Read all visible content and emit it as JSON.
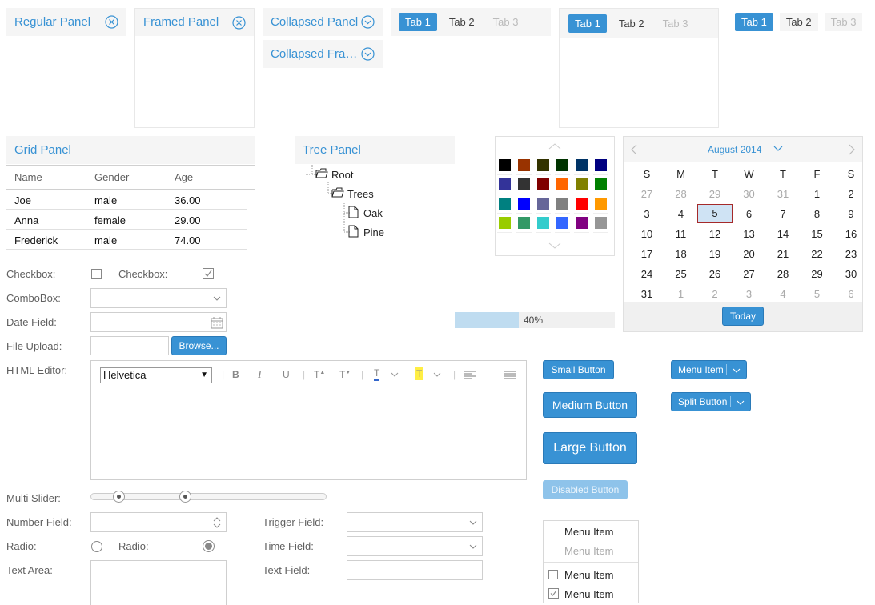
{
  "panels": {
    "regular": {
      "title": "Regular Panel"
    },
    "framed": {
      "title": "Framed Panel"
    },
    "collapsed": {
      "title": "Collapsed Panel"
    },
    "collapsed_framed": {
      "title": "Collapsed Fra…"
    }
  },
  "tabs": [
    "Tab 1",
    "Tab 2",
    "Tab 3"
  ],
  "grid": {
    "title": "Grid Panel",
    "columns": [
      "Name",
      "Gender",
      "Age"
    ],
    "rows": [
      [
        "Joe",
        "male",
        "36.00"
      ],
      [
        "Anna",
        "female",
        "29.00"
      ],
      [
        "Frederick",
        "male",
        "74.00"
      ]
    ]
  },
  "tree": {
    "title": "Tree Panel",
    "nodes": [
      "Root",
      "Trees",
      "Oak",
      "Pine"
    ]
  },
  "palette": {
    "colors": [
      "#000000",
      "#993300",
      "#333300",
      "#003300",
      "#003366",
      "#000080",
      "#333399",
      "#333333",
      "#800000",
      "#ff6600",
      "#808000",
      "#008000",
      "#008080",
      "#0000ff",
      "#666699",
      "#808080",
      "#ff0000",
      "#ff9900",
      "#99cc00",
      "#339966",
      "#33cccc",
      "#3366ff",
      "#800080",
      "#969696"
    ]
  },
  "calendar": {
    "month": "August 2014",
    "weekdays": [
      "S",
      "M",
      "T",
      "W",
      "T",
      "F",
      "S"
    ],
    "weeks": [
      [
        "27",
        "28",
        "29",
        "30",
        "31",
        "1",
        "2"
      ],
      [
        "3",
        "4",
        "5",
        "6",
        "7",
        "8",
        "9"
      ],
      [
        "10",
        "11",
        "12",
        "13",
        "14",
        "15",
        "16"
      ],
      [
        "17",
        "18",
        "19",
        "20",
        "21",
        "22",
        "23"
      ],
      [
        "24",
        "25",
        "26",
        "27",
        "28",
        "29",
        "30"
      ],
      [
        "31",
        "1",
        "2",
        "3",
        "4",
        "5",
        "6"
      ]
    ],
    "selected": "5",
    "today_label": "Today"
  },
  "progress": {
    "value": 0.4,
    "label": "40%"
  },
  "form": {
    "checkbox1_label": "Checkbox:",
    "checkbox2_label": "Checkbox:",
    "combobox_label": "ComboBox:",
    "datefield_label": "Date Field:",
    "fileupload_label": "File Upload:",
    "browse_label": "Browse...",
    "htmleditor_label": "HTML Editor:",
    "font_value": "Helvetica",
    "multislider_label": "Multi Slider:",
    "multislider_values": [
      0.12,
      0.4
    ],
    "numberfield_label": "Number Field:",
    "radio1_label": "Radio:",
    "radio2_label": "Radio:",
    "textarea_label": "Text Area:",
    "triggerfield_label": "Trigger Field:",
    "timefield_label": "Time Field:",
    "textfield_label": "Text Field:"
  },
  "buttons": {
    "small": "Small Button",
    "medium": "Medium Button",
    "large": "Large Button",
    "disabled": "Disabled Button",
    "menu_item": "Menu Item",
    "split": "Split Button"
  },
  "menu": {
    "items": [
      "Menu Item",
      "Menu Item",
      "Menu Item",
      "Menu Item"
    ]
  },
  "colors": {
    "accent": "#3892d4",
    "header_bg": "#f5f5f5"
  }
}
